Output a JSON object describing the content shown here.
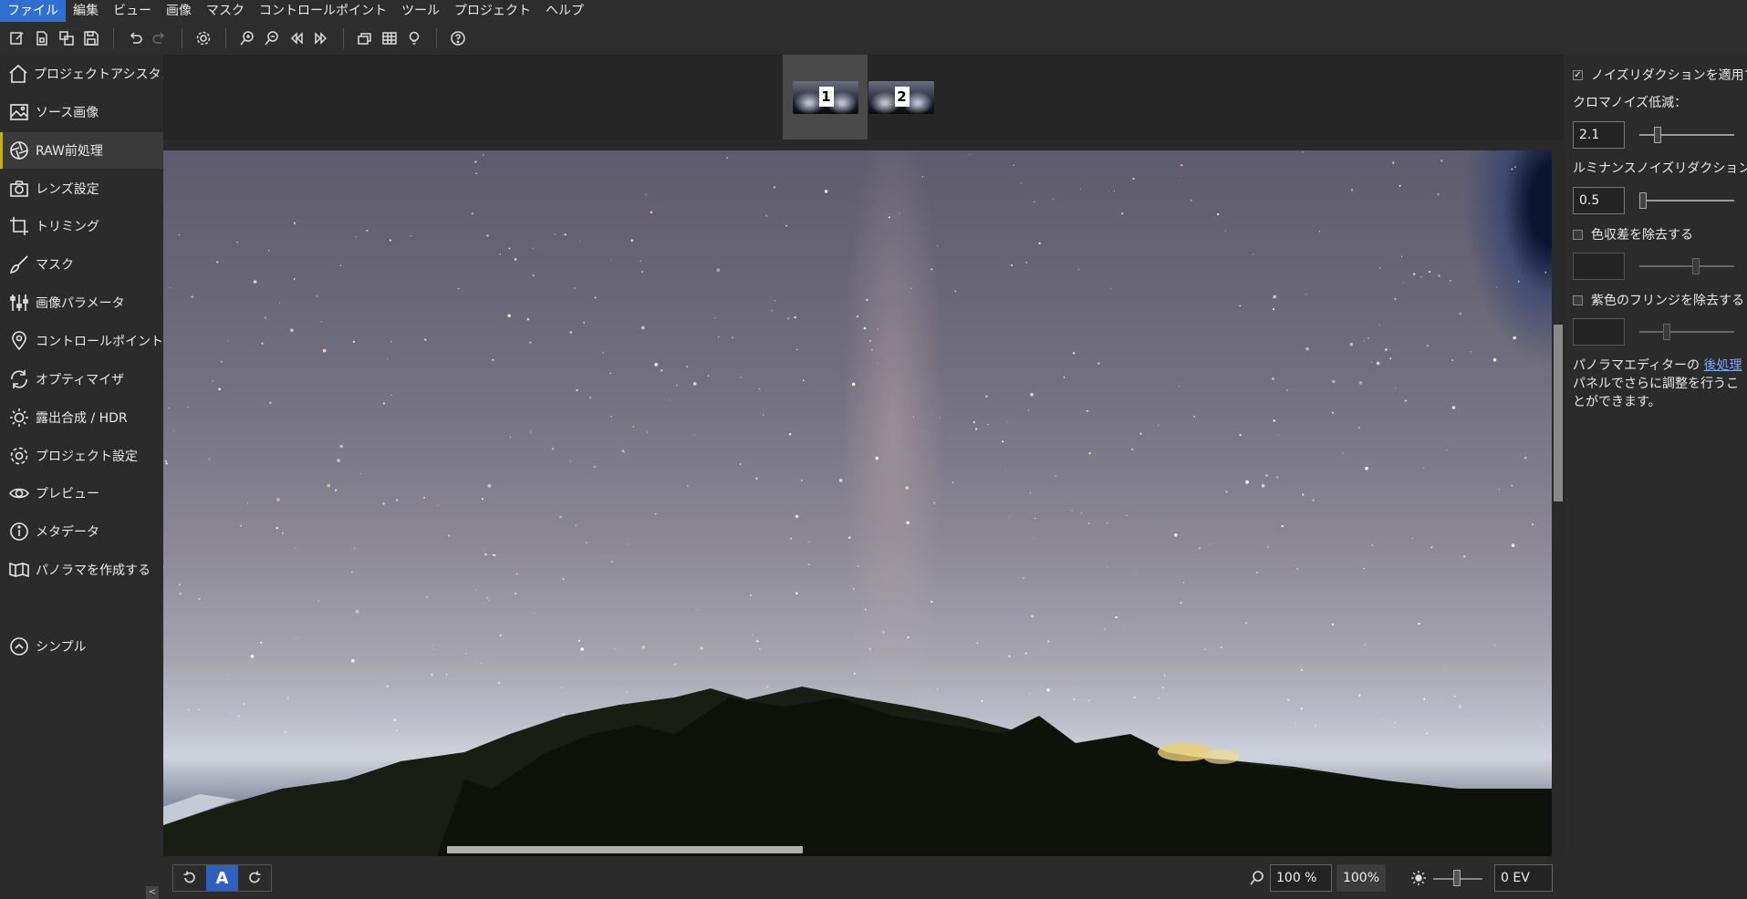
{
  "menu": [
    "ファイル",
    "編集",
    "ビュー",
    "画像",
    "マスク",
    "コントロールポイント",
    "ツール",
    "プロジェクト",
    "ヘルプ"
  ],
  "toolbar": {
    "icons": [
      "new-project-icon",
      "open-project-icon",
      "copy-icon",
      "save-icon",
      "undo-icon",
      "redo-icon",
      "settings-icon",
      "zoom-in-icon",
      "zoom-out-icon",
      "previous-icon",
      "next-icon",
      "stack-icon",
      "grid-icon",
      "bulb-icon",
      "help-icon"
    ]
  },
  "sidebar": {
    "items": [
      {
        "label": "プロジェクトアシスタント",
        "icon": "home-icon"
      },
      {
        "label": "ソース画像",
        "icon": "image-icon"
      },
      {
        "label": "RAW前処理",
        "icon": "aperture-icon",
        "active": true
      },
      {
        "label": "レンズ設定",
        "icon": "camera-icon"
      },
      {
        "label": "トリミング",
        "icon": "crop-icon"
      },
      {
        "label": "マスク",
        "icon": "brush-icon"
      },
      {
        "label": "画像パラメータ",
        "icon": "sliders-icon"
      },
      {
        "label": "コントロールポイント",
        "icon": "pin-icon"
      },
      {
        "label": "オプティマイザ",
        "icon": "refresh-icon"
      },
      {
        "label": "露出合成 / HDR",
        "icon": "sun-icon"
      },
      {
        "label": "プロジェクト設定",
        "icon": "gear-icon"
      },
      {
        "label": "プレビュー",
        "icon": "eye-icon"
      },
      {
        "label": "メタデータ",
        "icon": "info-icon"
      },
      {
        "label": "パノラマを作成する",
        "icon": "panorama-icon"
      }
    ],
    "simple": {
      "label": "シンプル",
      "icon": "chevron-up-icon"
    },
    "collapse_glyph": "<"
  },
  "filmstrip": {
    "thumbs": [
      {
        "number": "1",
        "selected": true
      },
      {
        "number": "2",
        "selected": false
      }
    ]
  },
  "bottom": {
    "auto_label": "A",
    "zoom_value": "100 %",
    "zoom_button": "100%",
    "ev_value": "0 EV"
  },
  "right_panel": {
    "noise_reduction_label": "ノイズリダクションを適用する",
    "noise_reduction_checked": true,
    "chroma_label": "クロマノイズ低減：",
    "chroma_value": "2.1",
    "luminance_label": "ルミナンスノイズリダクション:",
    "luminance_value": "0.5",
    "chromatic_aberration_label": "色収差を除去する",
    "chromatic_aberration_checked": false,
    "purple_fringe_label": "紫色のフリンジを除去する",
    "purple_fringe_checked": false,
    "note_before": "パノラマエディターの ",
    "note_link": "後処理",
    "note_after": " パネルでさらに調整を行うことができます。"
  }
}
